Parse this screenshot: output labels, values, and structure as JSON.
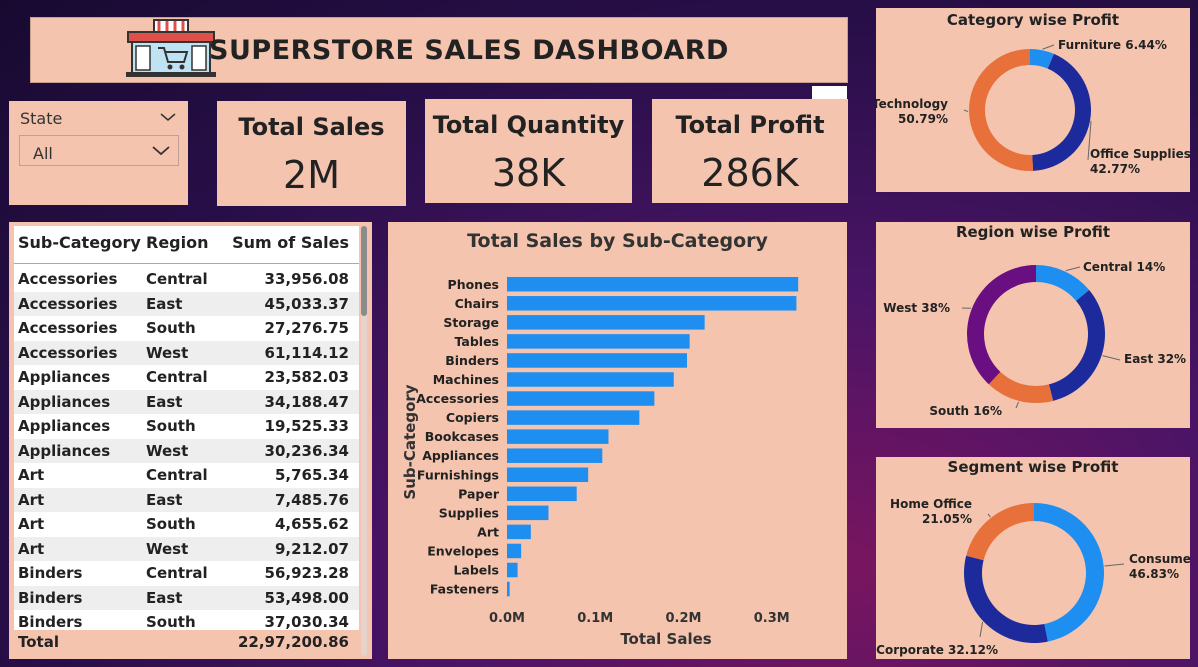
{
  "header": {
    "title": "SUPERSTORE SALES DASHBOARD",
    "logo_icon": "shopping-cart-store-icon"
  },
  "slicer": {
    "label": "State",
    "value": "All"
  },
  "kpis": {
    "sales": {
      "label": "Total Sales",
      "value": "2M"
    },
    "quantity": {
      "label": "Total Quantity",
      "value": "38K"
    },
    "profit": {
      "label": "Total Profit",
      "value": "286K"
    }
  },
  "more_menu": "…",
  "table": {
    "columns": [
      "Sub-Category",
      "Region",
      "Sum of Sales"
    ],
    "rows": [
      [
        "Accessories",
        "Central",
        "33,956.08"
      ],
      [
        "Accessories",
        "East",
        "45,033.37"
      ],
      [
        "Accessories",
        "South",
        "27,276.75"
      ],
      [
        "Accessories",
        "West",
        "61,114.12"
      ],
      [
        "Appliances",
        "Central",
        "23,582.03"
      ],
      [
        "Appliances",
        "East",
        "34,188.47"
      ],
      [
        "Appliances",
        "South",
        "19,525.33"
      ],
      [
        "Appliances",
        "West",
        "30,236.34"
      ],
      [
        "Art",
        "Central",
        "5,765.34"
      ],
      [
        "Art",
        "East",
        "7,485.76"
      ],
      [
        "Art",
        "South",
        "4,655.62"
      ],
      [
        "Art",
        "West",
        "9,212.07"
      ],
      [
        "Binders",
        "Central",
        "56,923.28"
      ],
      [
        "Binders",
        "East",
        "53,498.00"
      ],
      [
        "Binders",
        "South",
        "37,030.34"
      ]
    ],
    "total_label": "Total",
    "total_value": "22,97,200.86"
  },
  "chart_data": [
    {
      "type": "bar",
      "orientation": "horizontal",
      "title": "Total Sales by Sub-Category",
      "xlabel": "Total Sales",
      "ylabel": "Sub-Category",
      "x_ticks": [
        "0.0M",
        "0.1M",
        "0.2M",
        "0.3M"
      ],
      "xlim": [
        0,
        0.34
      ],
      "color": "#1f8ef1",
      "categories": [
        "Phones",
        "Chairs",
        "Storage",
        "Tables",
        "Binders",
        "Machines",
        "Accessories",
        "Copiers",
        "Bookcases",
        "Appliances",
        "Furnishings",
        "Paper",
        "Supplies",
        "Art",
        "Envelopes",
        "Labels",
        "Fasteners"
      ],
      "values": [
        0.33,
        0.328,
        0.224,
        0.207,
        0.204,
        0.189,
        0.167,
        0.15,
        0.115,
        0.108,
        0.092,
        0.079,
        0.047,
        0.027,
        0.016,
        0.012,
        0.003
      ]
    },
    {
      "type": "pie",
      "title": "Category wise Profit",
      "slices": [
        {
          "label": "Furniture",
          "value": 6.44,
          "text": "Furniture 6.44%",
          "color": "#1f8ef1"
        },
        {
          "label": "Office Supplies",
          "value": 42.77,
          "text_lines": [
            "Office Supplies",
            "42.77%"
          ],
          "color": "#1c2a9c"
        },
        {
          "label": "Technology",
          "value": 50.79,
          "text_lines": [
            "Technology",
            "50.79%"
          ],
          "color": "#e8703a"
        }
      ]
    },
    {
      "type": "pie",
      "title": "Region wise Profit",
      "slices": [
        {
          "label": "Central",
          "value": 14,
          "text": "Central 14%",
          "color": "#1f8ef1"
        },
        {
          "label": "East",
          "value": 32,
          "text": "East 32%",
          "color": "#1c2a9c"
        },
        {
          "label": "South",
          "value": 16,
          "text": "South 16%",
          "color": "#e8703a"
        },
        {
          "label": "West",
          "value": 38,
          "text": "West 38%",
          "color": "#6a0f82"
        }
      ]
    },
    {
      "type": "pie",
      "title": "Segment wise Profit",
      "slices": [
        {
          "label": "Consumer",
          "value": 46.83,
          "text_lines": [
            "Consumer",
            "46.83%"
          ],
          "color": "#1f8ef1"
        },
        {
          "label": "Corporate",
          "value": 32.12,
          "text": "Corporate 32.12%",
          "color": "#1c2a9c"
        },
        {
          "label": "Home Office",
          "value": 21.05,
          "text_lines": [
            "Home Office",
            "21.05%"
          ],
          "color": "#e8703a"
        }
      ]
    }
  ]
}
